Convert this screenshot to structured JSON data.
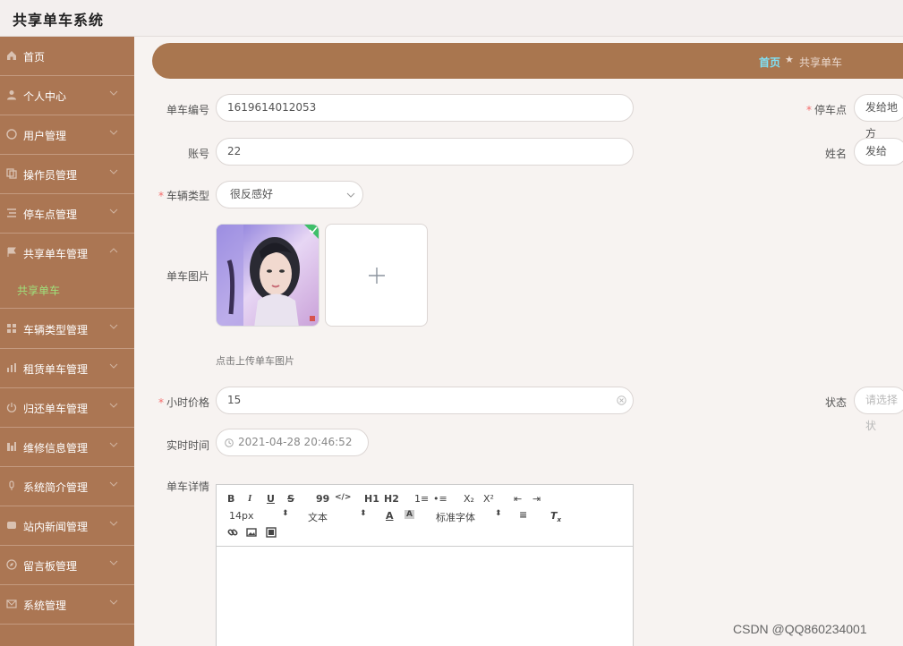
{
  "app": {
    "title": "共享单车系统"
  },
  "sidebar": {
    "items": [
      {
        "label": "首页",
        "icon": "home-icon"
      },
      {
        "label": "个人中心",
        "icon": "user-icon"
      },
      {
        "label": "用户管理",
        "icon": "users-icon"
      },
      {
        "label": "操作员管理",
        "icon": "copy-icon"
      },
      {
        "label": "停车点管理",
        "icon": "list-icon"
      },
      {
        "label": "共享单车管理",
        "icon": "flag-icon"
      },
      {
        "label": "车辆类型管理",
        "icon": "grid-icon"
      },
      {
        "label": "租赁单车管理",
        "icon": "bar-chart-icon"
      },
      {
        "label": "归还单车管理",
        "icon": "power-icon"
      },
      {
        "label": "维修信息管理",
        "icon": "column-chart-icon"
      },
      {
        "label": "系统简介管理",
        "icon": "mic-icon"
      },
      {
        "label": "站内新闻管理",
        "icon": "news-icon"
      },
      {
        "label": "留言板管理",
        "icon": "compass-icon"
      },
      {
        "label": "系统管理",
        "icon": "mail-icon"
      }
    ],
    "submenu_active": "共享单车"
  },
  "breadcrumb": {
    "home": "首页",
    "separator": "★",
    "current": "共享单车"
  },
  "form": {
    "bike_no_label": "单车编号",
    "bike_no_value": "1619614012053",
    "parking_label": "停车点",
    "parking_value": "发给地方",
    "account_label": "账号",
    "account_value": "22",
    "name_label": "姓名",
    "name_value": "发给",
    "type_label": "车辆类型",
    "type_value": "很反感好",
    "image_label": "单车图片",
    "image_hint": "点击上传单车图片",
    "price_label": "小时价格",
    "price_value": "15",
    "status_label": "状态",
    "status_placeholder": "请选择状",
    "time_label": "实时时间",
    "time_value": "2021-04-28 20:46:52",
    "detail_label": "单车详情"
  },
  "editor": {
    "row1": [
      "B",
      "I",
      "U",
      "S",
      "99",
      "</>",
      "H1",
      "H2",
      "1≡",
      "•≡",
      "X₂",
      "X²",
      "⇤",
      "⇥"
    ],
    "font_size": "14px",
    "paragraph": "文本",
    "font_family": "标准字体"
  },
  "watermark": "CSDN @QQ860234001",
  "colors": {
    "sidebar": "#ab7653",
    "breadcrumb": "#a9764f",
    "active_submenu": "#9fe07b",
    "required": "#f56c6c"
  }
}
